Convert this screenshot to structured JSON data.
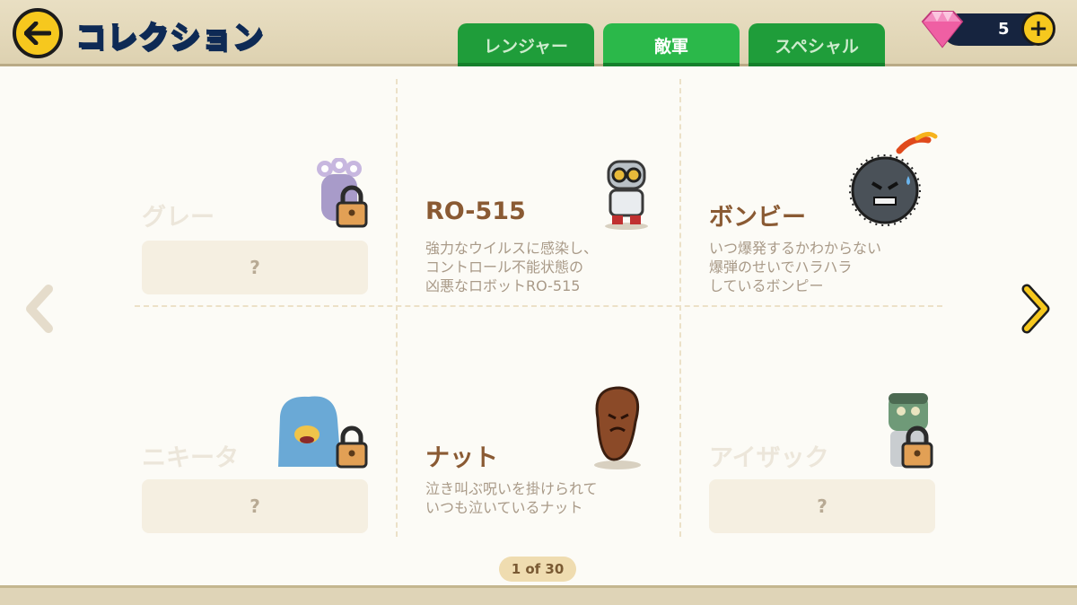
{
  "header": {
    "title": "コレクション",
    "gems": "5",
    "plus_label": "+"
  },
  "tabs": [
    {
      "label": "レンジャー",
      "active": false
    },
    {
      "label": "敵軍",
      "active": true
    },
    {
      "label": "スペシャル",
      "active": false
    }
  ],
  "cards": [
    {
      "name": "グレー",
      "locked": true,
      "placeholder": "?"
    },
    {
      "name": "RO-515",
      "locked": false,
      "description": "強力なウイルスに感染し、\nコントロール不能状態の\n凶悪なロボットRO-515"
    },
    {
      "name": "ボンビー",
      "locked": false,
      "description": "いつ爆発するかわからない\n爆弾のせいでハラハラ\nしているボンピー"
    },
    {
      "name": "ニキータ",
      "locked": true,
      "placeholder": "?"
    },
    {
      "name": "ナット",
      "locked": false,
      "description": "泣き叫ぶ呪いを掛けられて\nいつも泣いているナット"
    },
    {
      "name": "アイザック",
      "locked": true,
      "placeholder": "?"
    }
  ],
  "pager": {
    "label": "1 of 30"
  },
  "colors": {
    "tab_active": "#2bb84a",
    "tab_inactive": "#1f9d3a",
    "name_brown": "#8a5a33",
    "accent_yellow": "#f6c81e"
  }
}
